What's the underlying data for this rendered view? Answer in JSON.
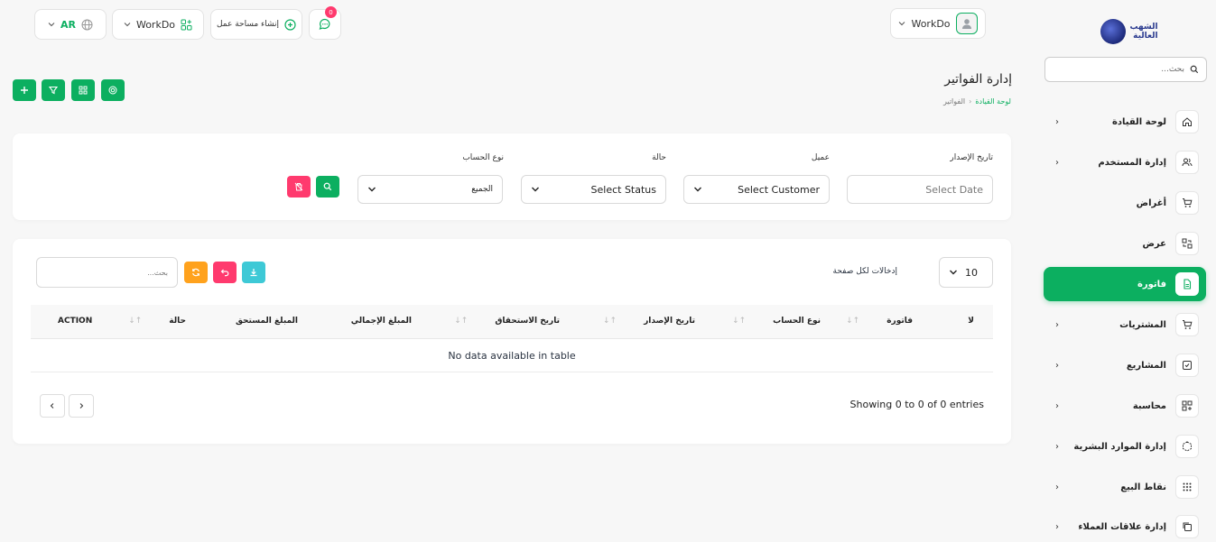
{
  "sidebar": {
    "logo_text_line1": "الشهب",
    "logo_text_line2": "العالية",
    "search_placeholder": "بحث...",
    "items": [
      {
        "label": "لوحة القيادة",
        "icon": "home-icon",
        "chevron": true
      },
      {
        "label": "إدارة المستخدم",
        "icon": "users-icon",
        "chevron": true
      },
      {
        "label": "أغراض",
        "icon": "cart-icon",
        "chevron": false
      },
      {
        "label": "عرض",
        "icon": "transfer-icon",
        "chevron": false
      },
      {
        "label": "فاتورة",
        "icon": "file-invoice-icon",
        "chevron": false,
        "active": true
      },
      {
        "label": "المشتريات",
        "icon": "cart-icon",
        "chevron": true
      },
      {
        "label": "المشاريع",
        "icon": "checkbox-icon",
        "chevron": true
      },
      {
        "label": "محاسبة",
        "icon": "apps-plus-icon",
        "chevron": true
      },
      {
        "label": "إدارة الموارد البشرية",
        "icon": "hexagon-icon",
        "chevron": true
      },
      {
        "label": "نقاط البيع",
        "icon": "grid-dots-icon",
        "chevron": true
      },
      {
        "label": "إدارة علاقات العملاء",
        "icon": "copy-icon",
        "chevron": true
      }
    ]
  },
  "topbar": {
    "user_name": "WorkDo",
    "notification_count": "0",
    "create_workspace": "إنشاء مساحة عمل",
    "workspace_name": "WorkDo",
    "language": "AR"
  },
  "page": {
    "title": "إدارة الفواتير",
    "breadcrumb_home": "لوحة القيادة",
    "breadcrumb_current": "الفواتير"
  },
  "filters": {
    "issue_date_label": "تاريخ الإصدار",
    "issue_date_placeholder": "Select Date",
    "customer_label": "عميل",
    "customer_value": "Select Customer",
    "status_label": "حالة",
    "status_value": "Select Status",
    "account_type_label": "نوع الحساب",
    "account_type_value": "الجميع"
  },
  "table": {
    "per_page_value": "10",
    "per_page_label": "إدخالات لكل صفحة",
    "search_placeholder": "بحث...",
    "columns": [
      "لا",
      "فاتورة",
      "نوع الحساب",
      "تاريخ الإصدار",
      "تاريخ الاستحقاق",
      "المبلغ الإجمالي",
      "المبلغ المستحق",
      "حالة",
      "ACTION"
    ],
    "empty_message": "No data available in table",
    "showing": "Showing 0 to 0 of 0 entries"
  },
  "colors": {
    "primary": "#0caf60",
    "danger": "#ff3a6e",
    "warning": "#ffa21d",
    "info": "#3ec9d6"
  }
}
